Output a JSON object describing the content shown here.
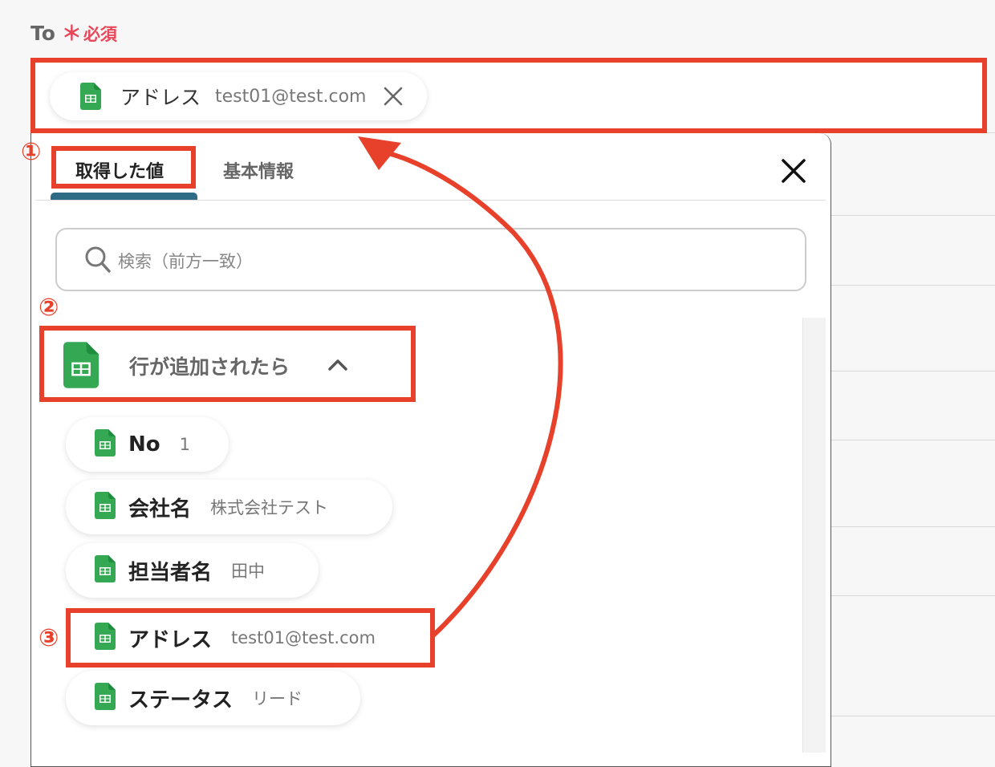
{
  "field": {
    "label": "To",
    "star": "＊",
    "required": "必須"
  },
  "selected_chip": {
    "key": "アドレス",
    "value": "test01@test.com",
    "remove_icon": "close-icon"
  },
  "panel": {
    "tabs": [
      {
        "label": "取得した値",
        "active": true
      },
      {
        "label": "基本情報",
        "active": false
      }
    ],
    "close_icon": "close-icon",
    "search": {
      "placeholder": "検索（前方一致）",
      "icon": "search-icon"
    },
    "group": {
      "title": "行が追加されたら",
      "icon": "google-sheets-icon",
      "toggle_icon": "chevron-up-icon"
    },
    "items": [
      {
        "key": "No",
        "value": "1"
      },
      {
        "key": "会社名",
        "value": "株式会社テスト"
      },
      {
        "key": "担当者名",
        "value": "田中"
      },
      {
        "key": "アドレス",
        "value": "test01@test.com"
      },
      {
        "key": "ステータス",
        "value": "リード"
      }
    ]
  },
  "annotations": {
    "step1": "①",
    "step2": "②",
    "step3": "③"
  },
  "colors": {
    "annotation": "#e8412b",
    "required": "#e8475a",
    "sheets": "#34a853",
    "tab_underline": "#2e6b85"
  }
}
